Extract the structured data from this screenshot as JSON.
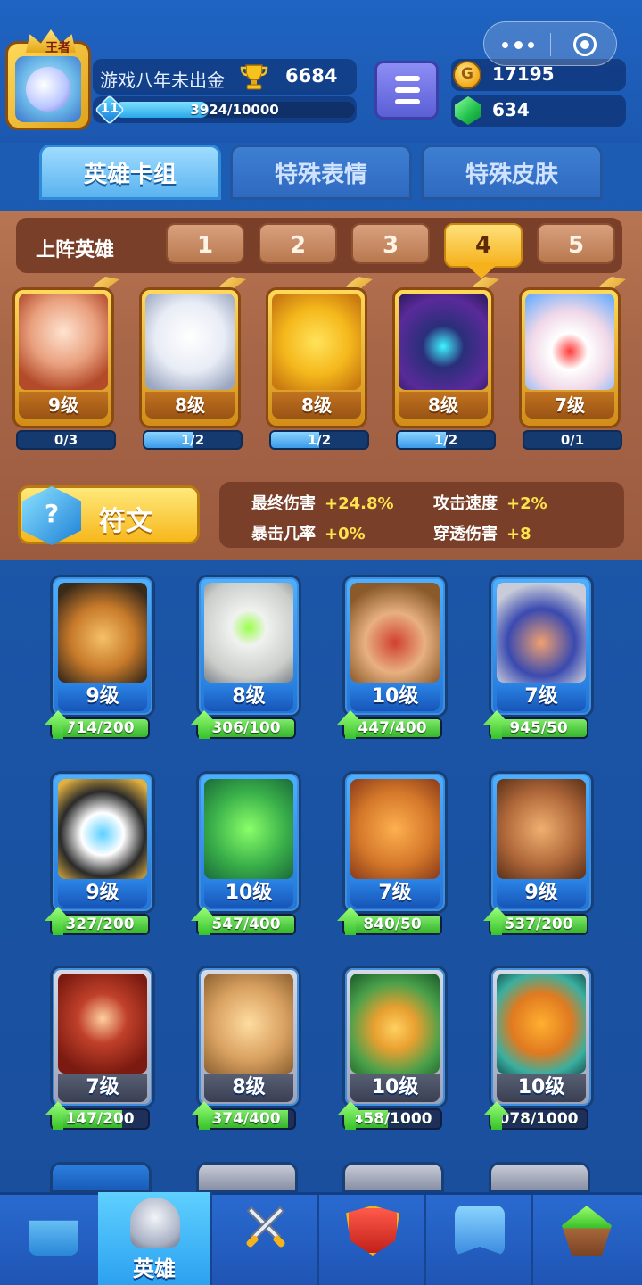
{
  "header": {
    "player_name": "游戏八年未出金",
    "avatar_badge": "王者",
    "trophies": "6684",
    "level": "11",
    "xp_text": "3924/10000",
    "xp_fraction": 0.3924,
    "gold": "17195",
    "gems": "634"
  },
  "tabs": [
    {
      "label": "英雄卡组",
      "active": true
    },
    {
      "label": "特殊表情",
      "active": false
    },
    {
      "label": "特殊皮肤",
      "active": false
    }
  ],
  "lineup": {
    "title": "上阵英雄",
    "slots": [
      "1",
      "2",
      "3",
      "4",
      "5"
    ],
    "active_slot": "4",
    "heroes": [
      {
        "level": "9级",
        "progress": "0/3",
        "fraction": 0.0,
        "art": "hero-fan-girl"
      },
      {
        "level": "8级",
        "progress": "1/2",
        "fraction": 0.5,
        "art": "hero-ghost"
      },
      {
        "level": "8级",
        "progress": "1/2",
        "fraction": 0.5,
        "art": "hero-chef"
      },
      {
        "level": "8级",
        "progress": "1/2",
        "fraction": 0.5,
        "art": "hero-dark-mage"
      },
      {
        "level": "7级",
        "progress": "0/1",
        "fraction": 0.0,
        "art": "hero-clown"
      }
    ],
    "rune_label": "符文",
    "stats": [
      {
        "label": "最终伤害",
        "value": "+24.8%"
      },
      {
        "label": "攻击速度",
        "value": "+2%"
      },
      {
        "label": "暴击几率",
        "value": "+0%"
      },
      {
        "label": "穿透伤害",
        "value": "+8"
      }
    ]
  },
  "cards": [
    {
      "level": "9级",
      "progress": "714/200",
      "frame": "blue",
      "art": "cowboy-gunner"
    },
    {
      "level": "8级",
      "progress": "306/100",
      "frame": "blue",
      "art": "mummy"
    },
    {
      "level": "10级",
      "progress": "447/400",
      "frame": "blue",
      "art": "bandit"
    },
    {
      "level": "7级",
      "progress": "945/50",
      "frame": "blue",
      "art": "helmet-soldier"
    },
    {
      "level": "9级",
      "progress": "327/200",
      "frame": "blue",
      "art": "panda-monk"
    },
    {
      "level": "10级",
      "progress": "547/400",
      "frame": "blue",
      "art": "frog-detective"
    },
    {
      "level": "7级",
      "progress": "840/50",
      "frame": "blue",
      "art": "archer-girl"
    },
    {
      "level": "9级",
      "progress": "537/200",
      "frame": "blue",
      "art": "bear-warrior"
    },
    {
      "level": "7级",
      "progress": "147/200",
      "frame": "gray",
      "art": "goggle-engineer"
    },
    {
      "level": "8级",
      "progress": "374/400",
      "frame": "gray",
      "art": "ogre"
    },
    {
      "level": "10级",
      "progress": "458/1000",
      "frame": "gray",
      "art": "hooded-ranger"
    },
    {
      "level": "10级",
      "progress": "078/1000",
      "frame": "gray",
      "art": "tribal-mask"
    }
  ],
  "bottom_nav": [
    {
      "label": "",
      "icon": "treasure-chest-icon"
    },
    {
      "label": "英雄",
      "icon": "knight-helmet-icon",
      "active": true
    },
    {
      "label": "",
      "icon": "crossed-swords-icon"
    },
    {
      "label": "",
      "icon": "crown-shield-icon"
    },
    {
      "label": "",
      "icon": "team-banner-icon"
    },
    {
      "label": "",
      "icon": "sprout-island-icon"
    }
  ],
  "colors": {
    "background": "#1b56a8",
    "lineup_panel": "#a86648",
    "gold_accent": "#f5b21c",
    "progress_green": "#35b52a",
    "stat_value": "#ffe34d"
  }
}
